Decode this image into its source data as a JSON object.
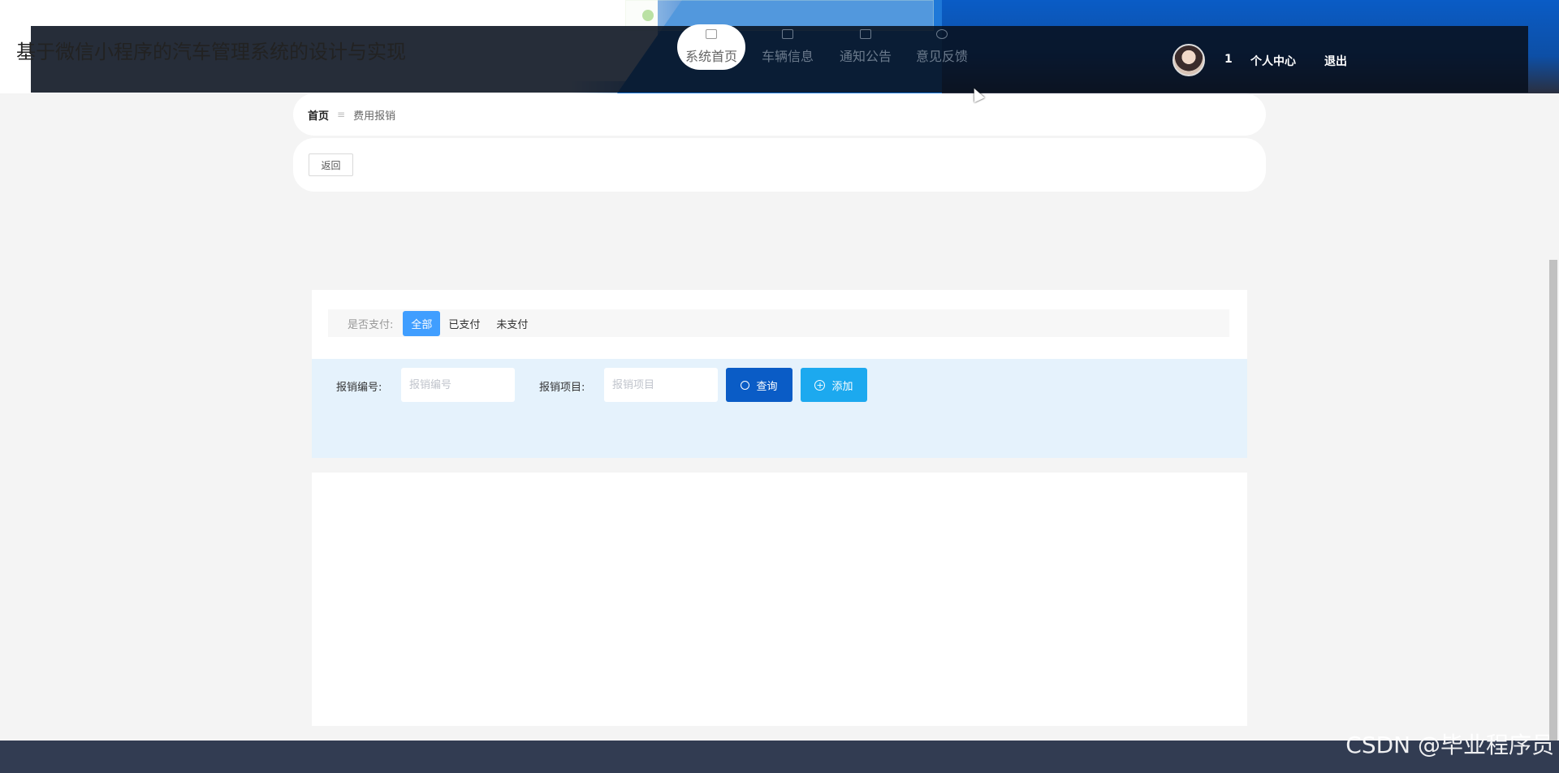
{
  "header": {
    "title": "基于微信小程序的汽车管理系统的设计与实现",
    "nav": [
      {
        "label": "系统首页",
        "icon": "home-icon",
        "active": true
      },
      {
        "label": "车辆信息",
        "icon": "car-icon",
        "active": false
      },
      {
        "label": "通知公告",
        "icon": "notice-icon",
        "active": false
      },
      {
        "label": "意见反馈",
        "icon": "feedback-icon",
        "active": false
      }
    ],
    "user_id": "1",
    "user_center": "个人中心",
    "logout": "退出"
  },
  "breadcrumb": {
    "home": "首页",
    "separator": "≡",
    "current": "费用报销"
  },
  "back_button": "返回",
  "filter": {
    "label": "是否支付:",
    "options": [
      {
        "label": "全部",
        "active": true
      },
      {
        "label": "已支付",
        "active": false
      },
      {
        "label": "未支付",
        "active": false
      }
    ]
  },
  "search": {
    "code_label": "报销编号:",
    "code_placeholder": "报销编号",
    "item_label": "报销项目:",
    "item_placeholder": "报销项目",
    "query_button": "查询",
    "add_button": "添加"
  },
  "watermark": "CSDN @毕业程序员",
  "colors": {
    "primary": "#0a5cc6",
    "accent": "#1ca9ef",
    "active_filter": "#409eff",
    "search_bg": "#e5f2fc",
    "footer": "#323c52"
  }
}
